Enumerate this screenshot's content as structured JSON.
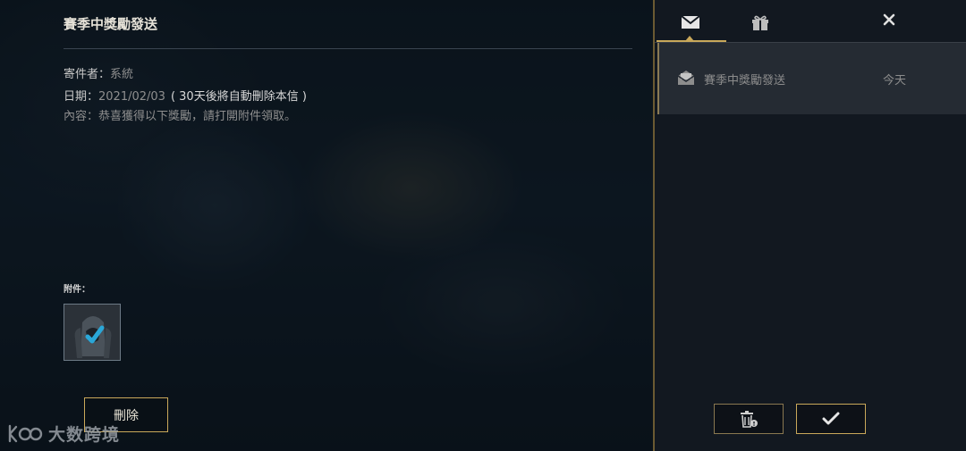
{
  "mail": {
    "title": "賽季中獎勵發送",
    "sender_label": "寄件者：",
    "sender_value": "系統",
    "date_label": "日期：",
    "date_value": "2021/02/03",
    "date_note": "( 30天後將自動刪除本信 )",
    "content_label": "內容：",
    "content_value": "恭喜獲得以下獎勵，請打開附件領取。",
    "attachments_label": "附件：",
    "delete_label": "刪除"
  },
  "panel": {
    "tabs": [
      {
        "icon": "mail-icon",
        "active": true
      },
      {
        "icon": "gift-icon",
        "active": false
      }
    ],
    "close_icon": "close-icon",
    "list": [
      {
        "subject": "賽季中獎勵發送",
        "date": "今天",
        "icon": "envelope-open-icon"
      }
    ]
  },
  "watermark": {
    "text": "大数跨境"
  },
  "colors": {
    "accent_gold": "#c9a85a",
    "panel_bg": "#121820",
    "selected_row": "#252b33"
  }
}
